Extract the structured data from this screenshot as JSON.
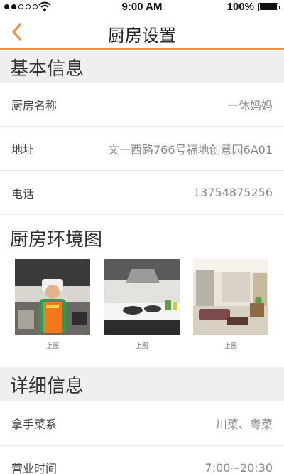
{
  "status_bar": {
    "time": "9:00 AM",
    "battery_percent": "100%",
    "battery_level": 1.0,
    "signal_bars": 2
  },
  "nav": {
    "title": "厨房设置",
    "back_icon": "chevron-left-icon",
    "accent_color": "#e8914a"
  },
  "basic_info": {
    "header": "基本信息",
    "rows": [
      {
        "label": "厨房名称",
        "value": "一休妈妈"
      },
      {
        "label": "地址",
        "value": "文一西路766号福地创意园6A01"
      },
      {
        "label": "电话",
        "value": "13754875256"
      }
    ]
  },
  "environment": {
    "header": "厨房环境图",
    "photos": [
      {
        "caption": "上图",
        "subject": "chef-photo"
      },
      {
        "caption": "上图",
        "subject": "kitchen-stove-photo"
      },
      {
        "caption": "上图",
        "subject": "living-room-photo"
      }
    ]
  },
  "detail_info": {
    "header": "详细信息",
    "rows": [
      {
        "label": "拿手菜系",
        "value": "川菜、粤菜"
      },
      {
        "label": "营业时间",
        "value": "7:00~20:30"
      }
    ]
  }
}
